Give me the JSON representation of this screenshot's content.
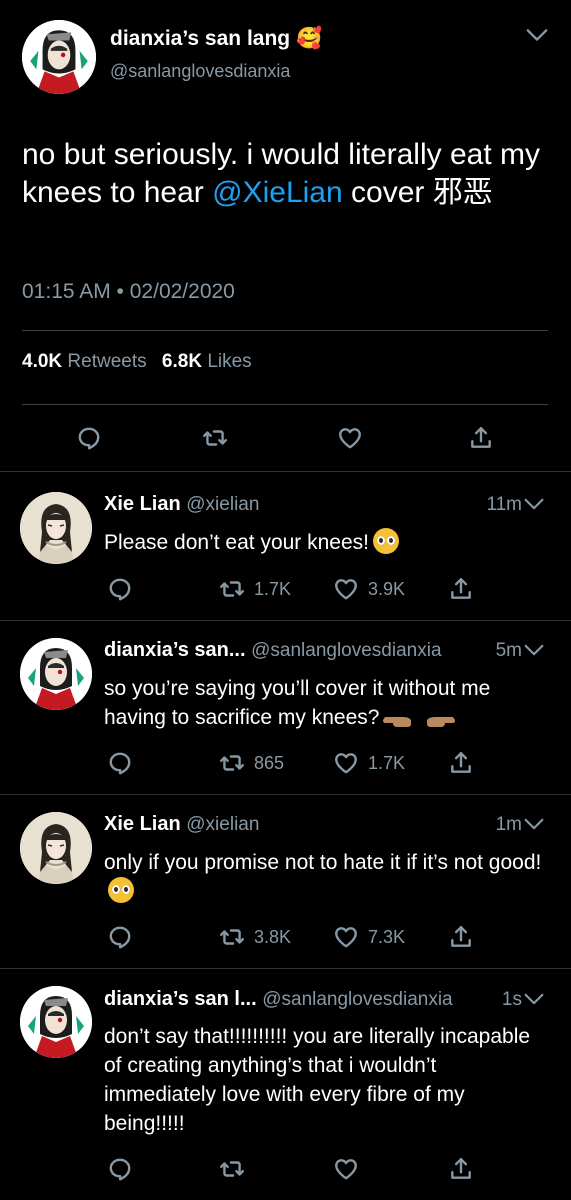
{
  "main_tweet": {
    "display_name": "dianxia’s san lang 🥰",
    "handle": "@sanlanglovesdianxia",
    "text_before": "no but seriously. i would literally eat my knees to hear ",
    "mention": "@XieLian",
    "text_after": " cover 邪恶",
    "timestamp": "01:15 AM • 02/02/2020",
    "retweets_count": "4.0K",
    "retweets_label": "Retweets",
    "likes_count": "6.8K",
    "likes_label": "Likes"
  },
  "replies": [
    {
      "display_name": "Xie Lian",
      "handle": "@xielian",
      "time": "11m",
      "text": "Please don’t eat your knees!",
      "retweets": "1.7K",
      "likes": "3.9K"
    },
    {
      "display_name": "dianxia’s san...",
      "handle": "@sanlanglovesdianxia",
      "time": "5m",
      "text": "so you’re saying you’ll cover it without me having to sacrifice my knees?",
      "retweets": "865",
      "likes": "1.7K"
    },
    {
      "display_name": "Xie Lian",
      "handle": "@xielian",
      "time": "1m",
      "text": "only if you promise not to hate it if it’s not good!",
      "retweets": "3.8K",
      "likes": "7.3K"
    },
    {
      "display_name": "dianxia’s san l...",
      "handle": "@sanlanglovesdianxia",
      "time": "1s",
      "text": "don’t say that!!!!!!!!!! you are literally incapable of creating anything’s that i wouldn’t immediately love with every fibre of my being!!!!!",
      "retweets": "",
      "likes": ""
    }
  ],
  "icons": {
    "reply": "reply-icon",
    "retweet": "retweet-icon",
    "like": "heart-icon",
    "share": "share-icon",
    "more": "chevron-down-icon"
  },
  "colors": {
    "background": "#000000",
    "link": "#1da1f2",
    "secondary_text": "#8899a6"
  }
}
